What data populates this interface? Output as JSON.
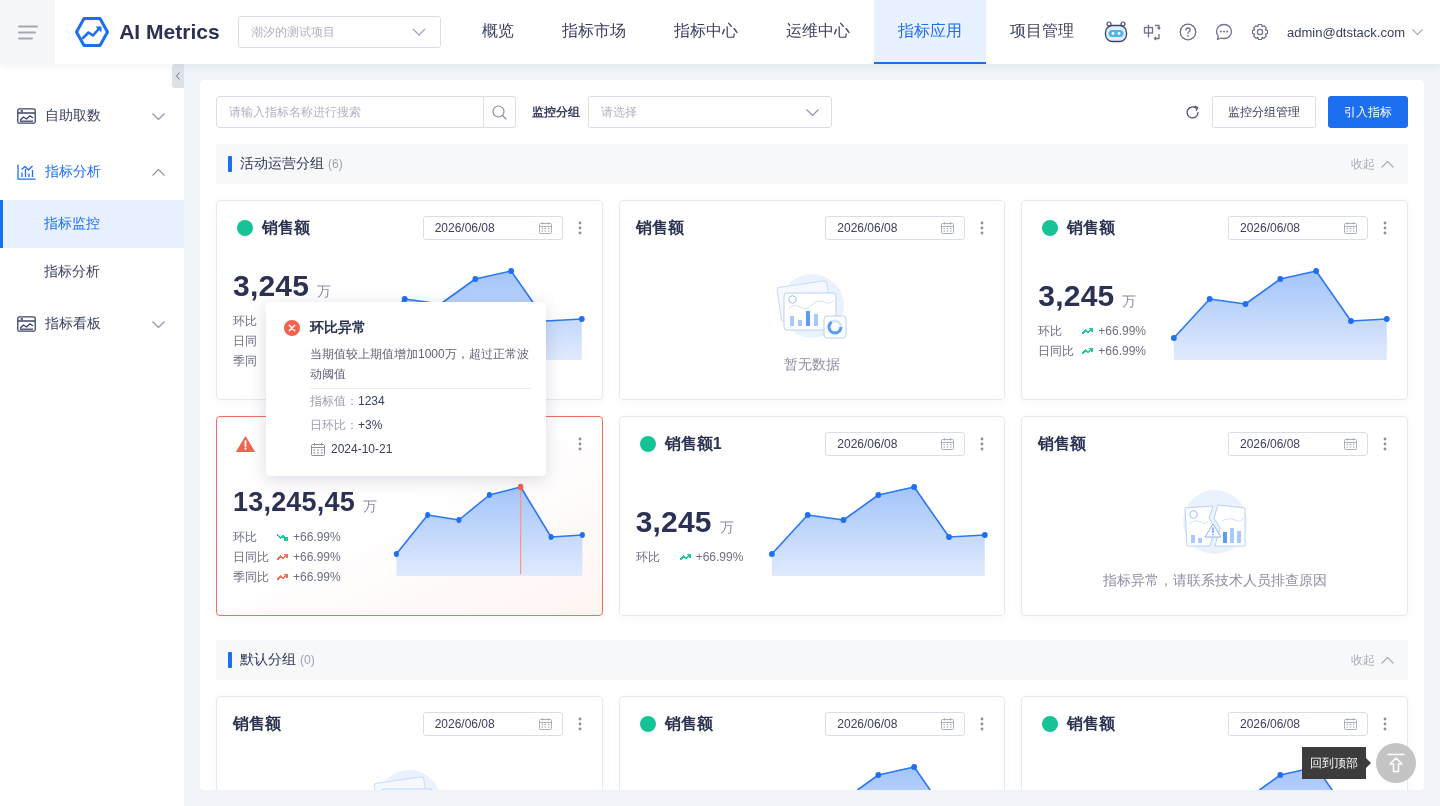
{
  "header": {
    "app_name": "AI Metrics",
    "project_select": {
      "placeholder": "潮汐的测试项目"
    },
    "nav": [
      {
        "label": "概览",
        "selected": false
      },
      {
        "label": "指标市场",
        "selected": false
      },
      {
        "label": "指标中心",
        "selected": false
      },
      {
        "label": "运维中心",
        "selected": false
      },
      {
        "label": "指标应用",
        "selected": true
      },
      {
        "label": "项目管理",
        "selected": false
      }
    ],
    "user": "admin@dtstack.com"
  },
  "sidebar": {
    "items": [
      {
        "label": "自助取数",
        "selected": false,
        "expanded": false
      },
      {
        "label": "指标分析",
        "selected": true,
        "expanded": true,
        "children": [
          {
            "label": "指标监控",
            "selected": true
          },
          {
            "label": "指标分析",
            "selected": false
          }
        ]
      },
      {
        "label": "指标看板",
        "selected": false,
        "expanded": false
      }
    ]
  },
  "toolbar": {
    "search": {
      "placeholder": "请输入指标名称进行搜索"
    },
    "group_filter": {
      "label": "监控分组",
      "placeholder": "请选择"
    },
    "buttons": [
      {
        "label": "监控分组管理",
        "kind": "default"
      },
      {
        "label": "引入指标",
        "kind": "primary"
      }
    ]
  },
  "groups": [
    {
      "title": "活动运营分组",
      "count": "(6)",
      "toggle": "收起",
      "expanded": true,
      "cards": [
        {
          "ok": true,
          "alert": false,
          "title": "销售额",
          "date": "2026/06/08",
          "kind": "chart",
          "value": "3,245",
          "unit": "万",
          "metrics": [
            {
              "label": "环比"
            },
            {
              "label": "日同"
            },
            {
              "label": "季同"
            }
          ]
        },
        {
          "ok": false,
          "alert": false,
          "title": "销售额",
          "date": "2026/06/08",
          "kind": "empty",
          "message": "暂无数据"
        },
        {
          "ok": true,
          "alert": false,
          "title": "销售额",
          "date": "2026/06/08",
          "kind": "chart",
          "value": "3,245",
          "unit": "万",
          "metrics": [
            {
              "label": "环比",
              "rising": true,
              "color": "#21c9a1",
              "value": "+66.99%"
            },
            {
              "label": "日同比",
              "rising": true,
              "color": "#21c9a1",
              "value": "+66.99%"
            }
          ]
        },
        {
          "ok": false,
          "alert": true,
          "kind": "chart",
          "value": "13,245,45",
          "unit": "万",
          "metrics": [
            {
              "label": "环比",
              "rising": false,
              "color": "#21c9a1",
              "value": "+66.99%"
            },
            {
              "label": "日同比",
              "rising": true,
              "color": "#f2705a",
              "value": "+66.99%"
            },
            {
              "label": "季同比",
              "rising": true,
              "color": "#f2705a",
              "value": "+66.99%"
            }
          ],
          "tooltip": {
            "title": "环比异常",
            "message": "当期值较上期值增加1000万，超过正常波动阈值",
            "rows": [
              {
                "label": "指标值：",
                "value": "1234"
              },
              {
                "label": "日环比：",
                "value": "+3%"
              }
            ],
            "date": "2024-10-21"
          }
        },
        {
          "ok": true,
          "alert": false,
          "title": "销售额1",
          "date": "2026/06/08",
          "kind": "chart",
          "value": "3,245",
          "unit": "万",
          "metrics": [
            {
              "label": "环比",
              "rising": true,
              "color": "#21c9a1",
              "value": "+66.99%"
            }
          ]
        },
        {
          "ok": false,
          "alert": false,
          "title": "销售额",
          "date": "2026/06/08",
          "kind": "error",
          "message": "指标异常，请联系技术人员排查原因"
        }
      ]
    },
    {
      "title": "默认分组",
      "count": "(0)",
      "toggle": "收起",
      "expanded": true,
      "cards": [
        {
          "ok": false,
          "alert": false,
          "title": "销售额",
          "date": "2026/06/08",
          "kind": "empty"
        },
        {
          "ok": true,
          "alert": false,
          "title": "销售额",
          "date": "2026/06/08",
          "kind": "chart"
        },
        {
          "ok": true,
          "alert": false,
          "title": "销售额",
          "date": "2026/06/08",
          "kind": "chart"
        }
      ]
    }
  ],
  "back_to_top": {
    "tooltip": "回到顶部"
  }
}
